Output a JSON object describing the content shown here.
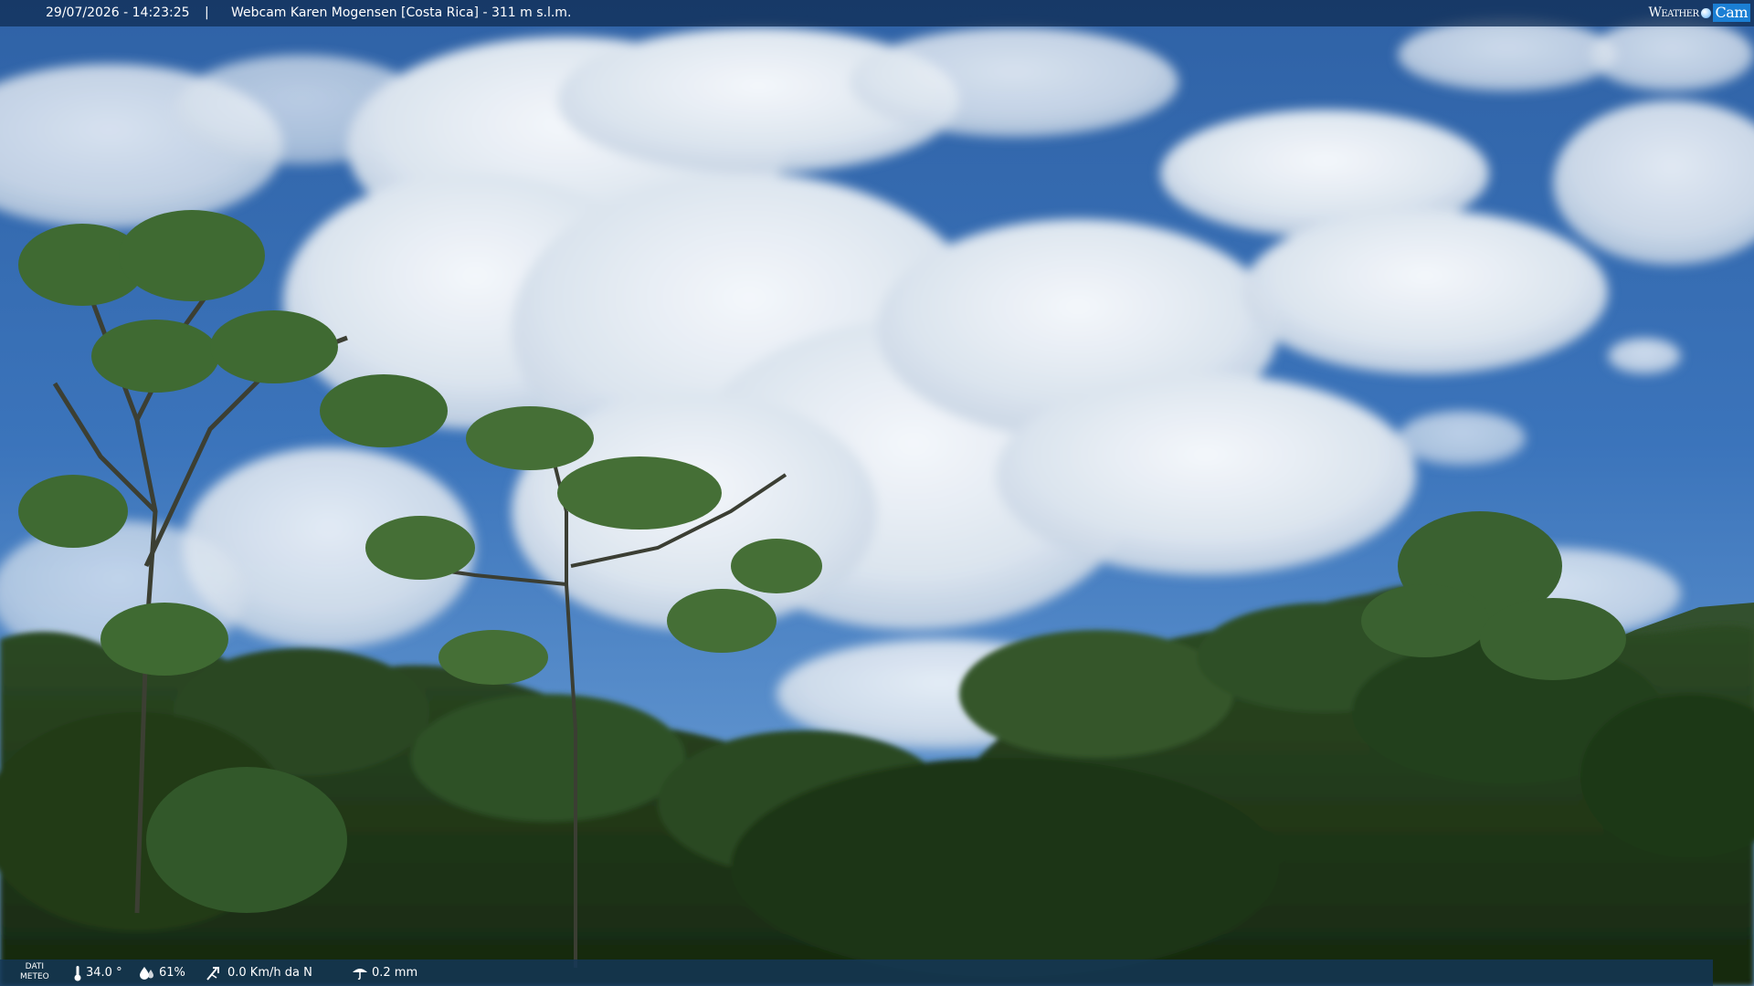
{
  "overlay": {
    "timestamp": "29/07/2026 - 14:23:25",
    "separator": "|",
    "title": "Webcam Karen Mogensen [Costa Rica] - 311 m s.l.m.",
    "logo": {
      "part1": "Weather",
      "part2": "Cam"
    }
  },
  "meteo": {
    "label_line1": "DATI",
    "label_line2": "METEO",
    "temperature": "34.0 °",
    "humidity": "61%",
    "wind": "0.0 Km/h da N",
    "rain": "0.2 mm"
  },
  "icons": [
    "thermometer-icon",
    "humidity-drop-icon",
    "wind-icon",
    "rain-icon"
  ],
  "colors": {
    "sky": "#3b72b8",
    "cloud": "#e9eef4",
    "foliage": "#2c4a22",
    "bar": "#112e56"
  }
}
